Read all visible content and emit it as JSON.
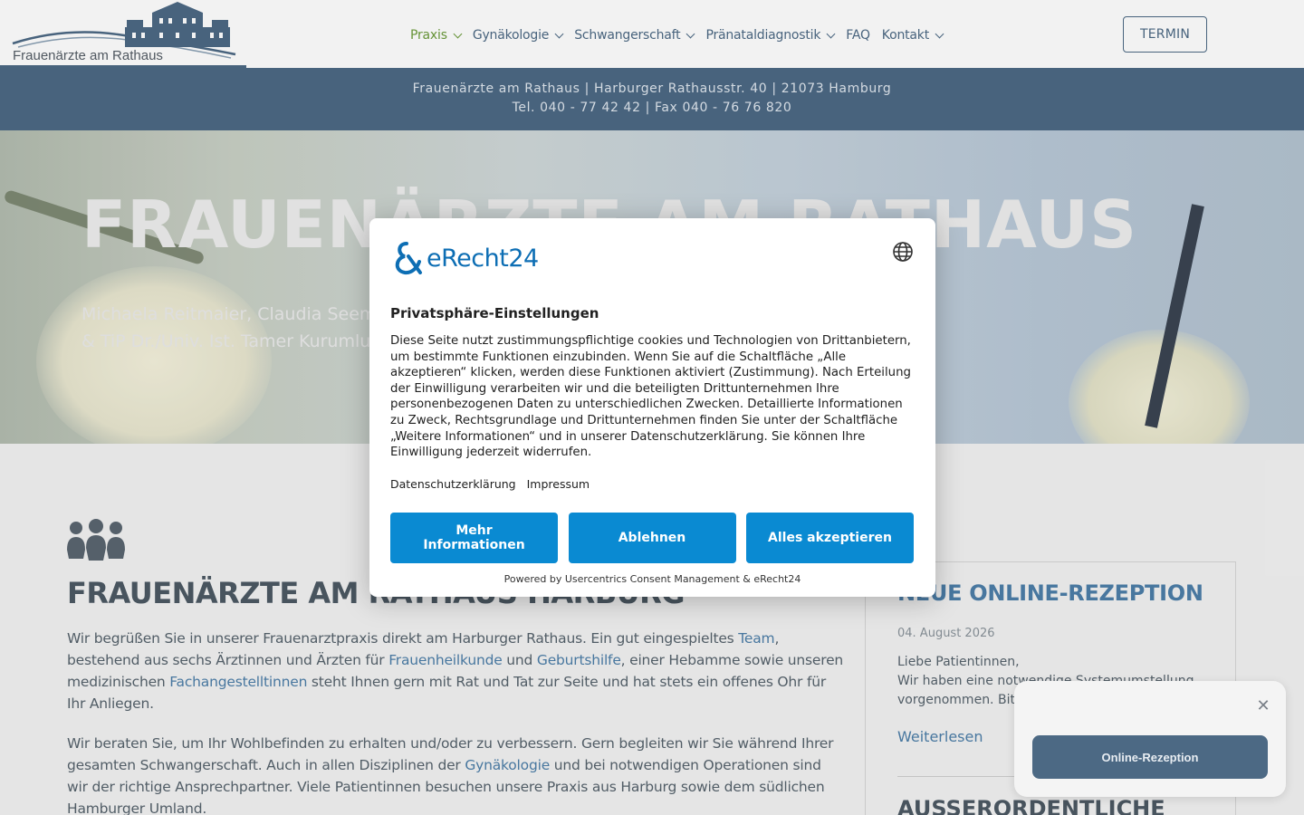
{
  "header": {
    "logo_text": "Frauenärzte am Rathaus",
    "nav": [
      {
        "label": "Praxis",
        "active": true,
        "dropdown": true
      },
      {
        "label": "Gynäkologie",
        "active": false,
        "dropdown": true
      },
      {
        "label": "Schwangerschaft",
        "active": false,
        "dropdown": true
      },
      {
        "label": "Pränataldiagnostik",
        "active": false,
        "dropdown": true
      },
      {
        "label": "FAQ",
        "active": false,
        "dropdown": false
      },
      {
        "label": "Kontakt",
        "active": false,
        "dropdown": true
      }
    ],
    "cta_label": "TERMIN"
  },
  "infobar": {
    "line1": "Frauenärzte am Rathaus | Harburger Rathausstr. 40 | 21073 Hamburg",
    "line2": "Tel. 040 - 77 42 42 | Fax 040 - 76 76 820"
  },
  "hero": {
    "title": "FRAUENÄRZTE AM RATHAUS",
    "subtitle_line1": "Michaela Reitmaier, Claudia Seem",
    "subtitle_line2": "& TiP Dr./Univ. Ist. Tamer Kurumlu"
  },
  "content": {
    "title": "FRAUENÄRZTE AM RATHAUS HARBURG",
    "para1": [
      {
        "t": "Wir begrüßen Sie in unserer Frauenarztpraxis direkt am Harburger Rathaus. Ein gut eingespieltes "
      },
      {
        "t": "Team",
        "link": true
      },
      {
        "t": ", bestehend aus sechs Ärztinnen und Ärzten für "
      },
      {
        "t": "Frauenheilkunde",
        "link": true
      },
      {
        "t": " und "
      },
      {
        "t": "Geburtshilfe",
        "link": true
      },
      {
        "t": ", einer Hebamme sowie unseren medizinischen "
      },
      {
        "t": "Fachangestelltinnen",
        "link": true
      },
      {
        "t": " steht Ihnen gern mit Rat und Tat zur Seite und hat stets ein offenes Ohr für Ihr Anliegen."
      }
    ],
    "para2": [
      {
        "t": "Wir beraten Sie, um Ihr Wohlbefinden zu erhalten und/oder zu verbessern. Gern begleiten wir Sie während Ihrer gesamten Schwangerschaft. Auch in allen Disziplinen der "
      },
      {
        "t": "Gynäkologie",
        "link": true
      },
      {
        "t": " und bei notwendigen Operationen sind wir der richtige Ansprechpartner. Viele Patientinnen besuchen unsere Praxis aus Harburg sowie dem südlichen Hamburger Umland."
      }
    ]
  },
  "news": {
    "title": "NEUE ONLINE-REZEPTION",
    "date": "04. August 2026",
    "text_line1": "Liebe Patientinnen,",
    "text_line2": "Wir haben eine notwendige Systemumstellung",
    "text_line3": "vorgenommen. Bitte",
    "more_label": "Weiterlesen",
    "title2": "AUSSERORDENTLICHE"
  },
  "rezeption_widget": {
    "close_symbol": "✕",
    "button_label": "Online-Rezeption"
  },
  "consent": {
    "brand": "eRecht24",
    "title": "Privatsphäre-Einstellungen",
    "text": "Diese Seite nutzt zustimmungspflichtige cookies und Technologien von Drittanbietern, um bestimmte Funktionen einzubinden. Wenn Sie auf die Schaltfläche „Alle akzeptieren“ klicken, werden diese Funktionen aktiviert (Zustimmung). Nach Erteilung der Einwilligung verarbeiten wir und die beteiligten Drittunternehmen Ihre personenbezogenen Daten zu unterschiedlichen Zwecken. Detaillierte Informationen zu Zweck, Rechtsgrundlage und Drittunternehmen finden Sie unter der Schaltfläche „Weitere Informationen“ und in unserer Datenschutzerklärung. Sie können Ihre Einwilligung jederzeit widerrufen.",
    "link_privacy": "Datenschutzerklärung",
    "link_imprint": "Impressum",
    "btn_more": "Mehr Informationen",
    "btn_deny": "Ablehnen",
    "btn_accept": "Alles akzeptieren",
    "powered_by": "Powered by Usercentrics Consent Management & eRecht24"
  },
  "colors": {
    "brand_blue": "#4c6984",
    "active_green": "#6c9b3c",
    "link_blue": "#4c7ea8",
    "consent_button": "#0a8ad2"
  },
  "icons": [
    "town-hall-logo-icon",
    "chevron-down-icon",
    "team-icon",
    "globe-icon",
    "close-icon"
  ]
}
